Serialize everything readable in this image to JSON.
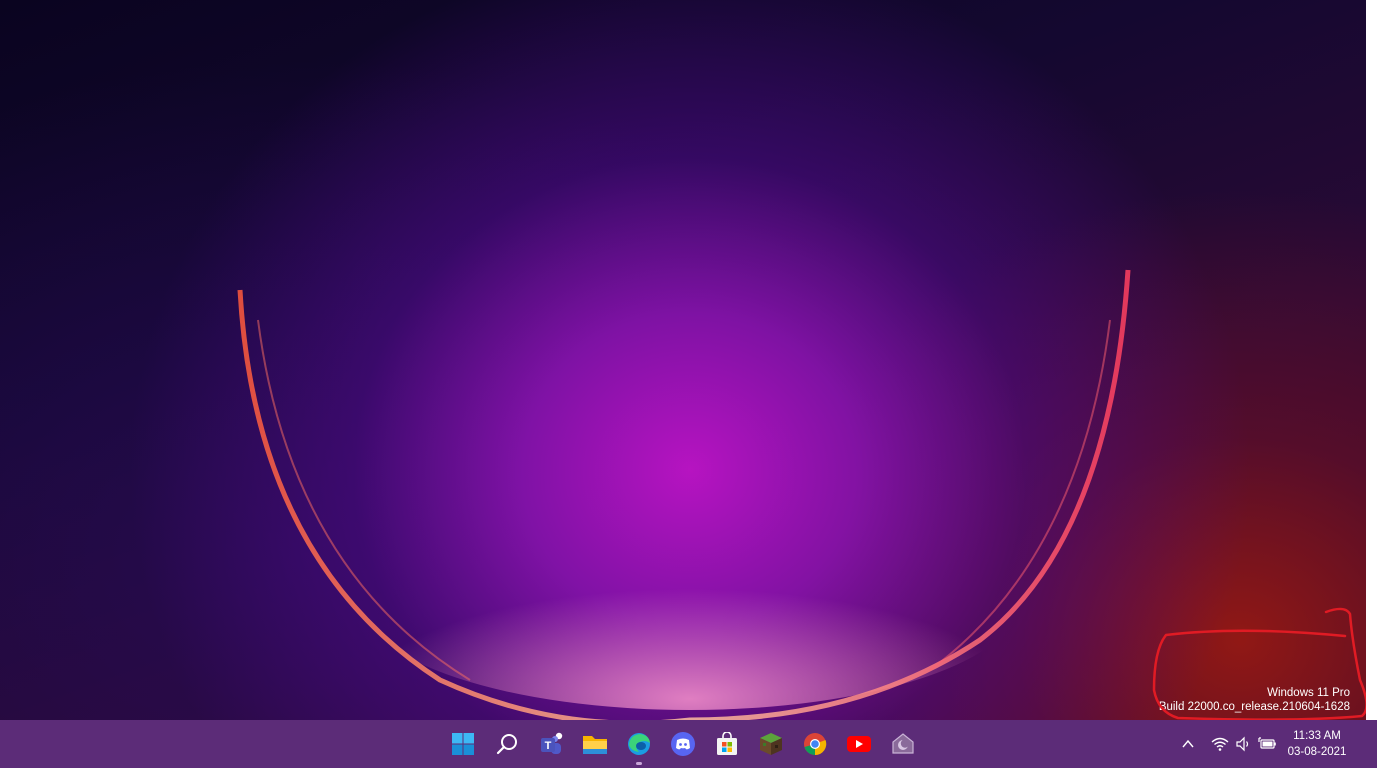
{
  "desktop": {
    "watermark": {
      "edition": "Windows 11 Pro",
      "build": "Build 22000.co_release.210604-1628"
    },
    "annotation_color": "#e01b24"
  },
  "taskbar": {
    "background": "#5c2c78",
    "pinned": [
      {
        "name": "start-button",
        "icon": "windows-logo-icon"
      },
      {
        "name": "search-button",
        "icon": "search-icon"
      },
      {
        "name": "teams-button",
        "icon": "teams-icon"
      },
      {
        "name": "file-explorer-button",
        "icon": "folder-icon"
      },
      {
        "name": "edge-button",
        "icon": "edge-icon",
        "active": true
      },
      {
        "name": "discord-button",
        "icon": "discord-icon"
      },
      {
        "name": "store-button",
        "icon": "store-icon"
      },
      {
        "name": "minecraft-button",
        "icon": "minecraft-icon"
      },
      {
        "name": "chrome-button",
        "icon": "chrome-icon"
      },
      {
        "name": "youtube-button",
        "icon": "youtube-icon"
      },
      {
        "name": "app-button",
        "icon": "moon-app-icon"
      }
    ],
    "tray": {
      "icons": [
        "chevron-up-icon",
        "wifi-icon",
        "volume-icon",
        "battery-icon"
      ],
      "time": "11:33 AM",
      "date": "03-08-2021"
    }
  }
}
